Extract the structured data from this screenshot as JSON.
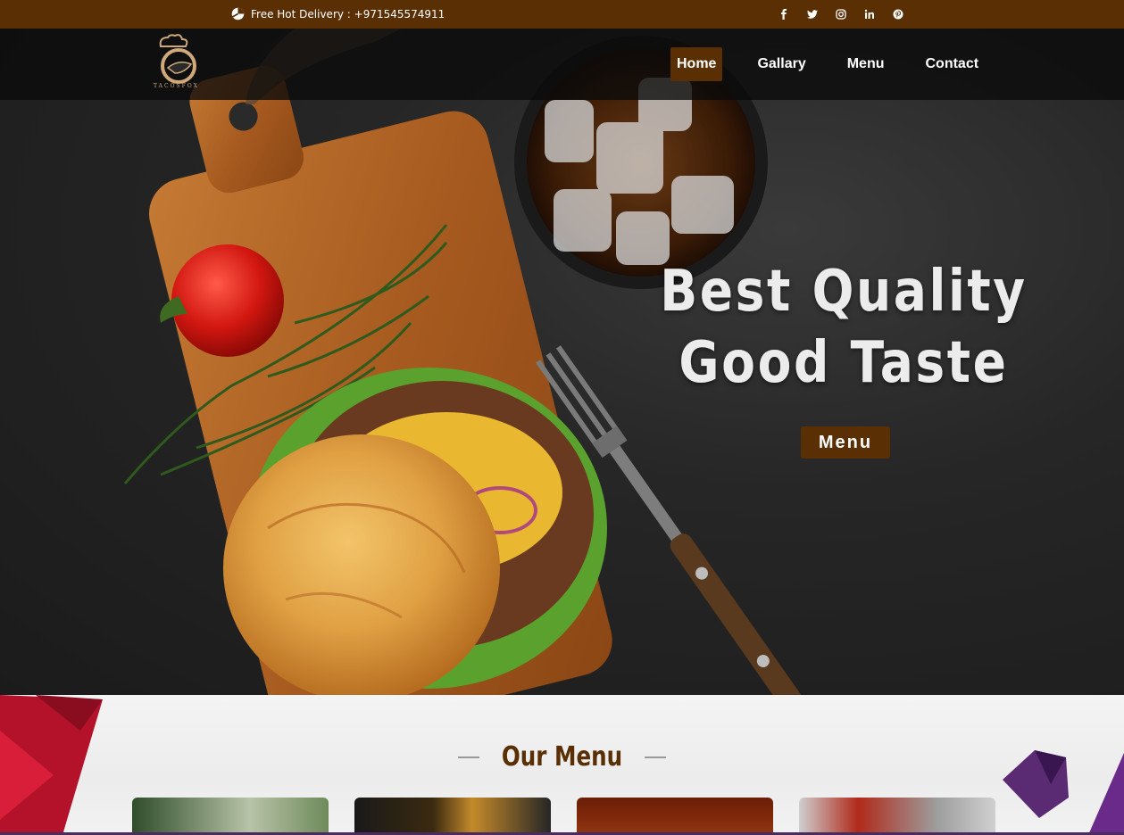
{
  "topbar": {
    "delivery_text": "Free Hot Delivery : +971545574911",
    "delivery_icon": "delivery-icon",
    "socials": [
      {
        "name": "facebook-icon",
        "glyph": "f"
      },
      {
        "name": "twitter-icon",
        "glyph": "t"
      },
      {
        "name": "instagram-icon",
        "glyph": "ig"
      },
      {
        "name": "linkedin-icon",
        "glyph": "in"
      },
      {
        "name": "pinterest-icon",
        "glyph": "p"
      }
    ]
  },
  "logo": {
    "text": "TACOSFOX"
  },
  "nav": {
    "items": [
      {
        "label": "Home",
        "active": true
      },
      {
        "label": "Gallary",
        "active": false
      },
      {
        "label": "Menu",
        "active": false
      },
      {
        "label": "Contact",
        "active": false
      }
    ]
  },
  "hero": {
    "line1": "Best Quality",
    "line2": "Good Taste",
    "button_label": "Menu"
  },
  "menu_section": {
    "title": "Our Menu"
  },
  "colors": {
    "brand_brown": "#5a2f04",
    "nav_bg": "#0a0a0a",
    "text_light": "#ececec"
  }
}
